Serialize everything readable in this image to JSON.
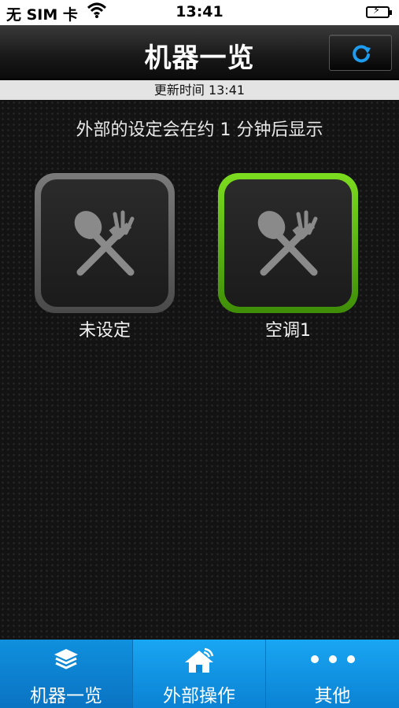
{
  "status_bar": {
    "carrier": "无 SIM 卡",
    "time": "13:41"
  },
  "header": {
    "title": "机器一览",
    "refresh_icon": "refresh-icon"
  },
  "update_strip": {
    "text": "更新时间 13:41"
  },
  "main": {
    "notice": "外部的设定会在约 1 分钟后显示",
    "devices": [
      {
        "label": "未设定",
        "icon": "utensils-icon",
        "state": "unset",
        "border_color": "#6a6a6a"
      },
      {
        "label": "空调1",
        "icon": "utensils-icon",
        "state": "active",
        "border_color": "#5fb813"
      }
    ]
  },
  "tab_bar": {
    "active_color": "#0b82d4",
    "tabs": [
      {
        "label": "机器一览",
        "icon": "layers-icon",
        "active": true
      },
      {
        "label": "外部操作",
        "icon": "home-wifi-icon",
        "active": false
      },
      {
        "label": "其他",
        "icon": "more-dots-icon",
        "active": false
      }
    ]
  }
}
